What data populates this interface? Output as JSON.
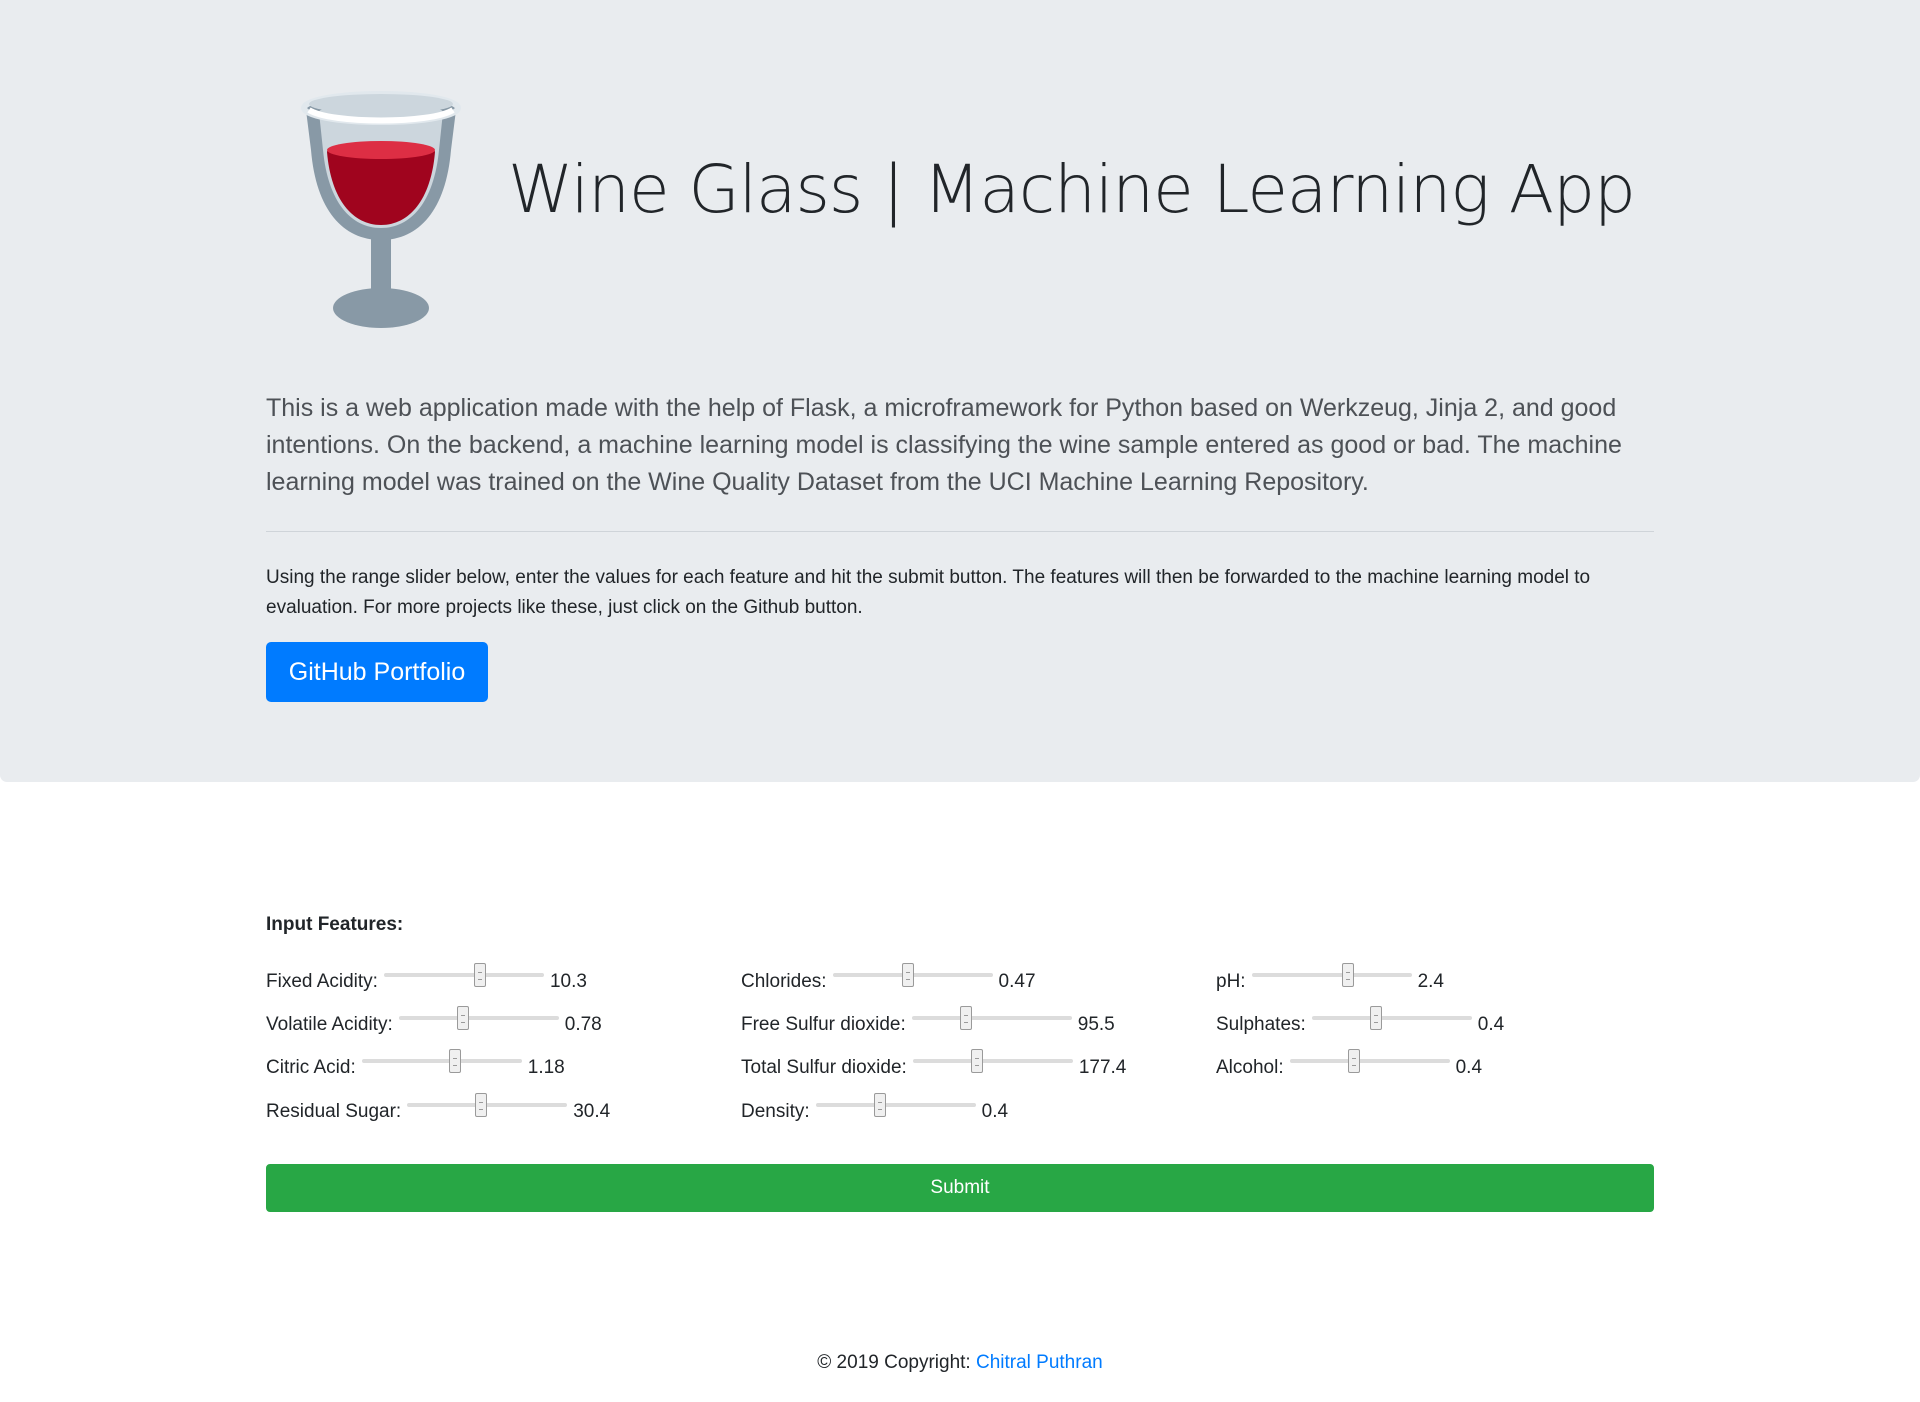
{
  "header": {
    "title": "Wine Glass | Machine Learning App",
    "icon": "wine-glass-icon",
    "description": "This is a web application made with the help of Flask, a microframework for Python based on Werkzeug, Jinja 2, and good intentions. On the backend, a machine learning model is classifying the wine sample entered as good or bad. The machine learning model was trained on the Wine Quality Dataset from the UCI Machine Learning Repository.",
    "instructions": "Using the range slider below, enter the values for each feature and hit the submit button. The features will then be forwarded to the machine learning model to evaluation. For more projects like these, just click on the Github button.",
    "github_button": "GitHub Portfolio"
  },
  "form": {
    "section_label": "Input Features:",
    "features": [
      {
        "label": "Fixed Acidity:",
        "value": "10.3",
        "level": 0.6
      },
      {
        "label": "Volatile Acidity:",
        "value": "0.78",
        "level": 0.4
      },
      {
        "label": "Citric Acid:",
        "value": "1.18",
        "level": 0.58
      },
      {
        "label": "Residual Sugar:",
        "value": "30.4",
        "level": 0.46
      },
      {
        "label": "Chlorides:",
        "value": "0.47",
        "level": 0.47
      },
      {
        "label": "Free Sulfur dioxide:",
        "value": "95.5",
        "level": 0.34
      },
      {
        "label": "Total Sulfur dioxide:",
        "value": "177.4",
        "level": 0.4
      },
      {
        "label": "Density:",
        "value": "0.4",
        "level": 0.4
      },
      {
        "label": "pH:",
        "value": "2.4",
        "level": 0.6
      },
      {
        "label": "Sulphates:",
        "value": "0.4",
        "level": 0.4
      },
      {
        "label": "Alcohol:",
        "value": "0.4",
        "level": 0.4
      }
    ],
    "submit_label": "Submit"
  },
  "footer": {
    "copyright": "© 2019 Copyright:",
    "author": "Chitral Puthran"
  },
  "colors": {
    "jumbotron": "#e9ecef",
    "primary": "#007bff",
    "success": "#28a745",
    "wine": "#be1931"
  }
}
